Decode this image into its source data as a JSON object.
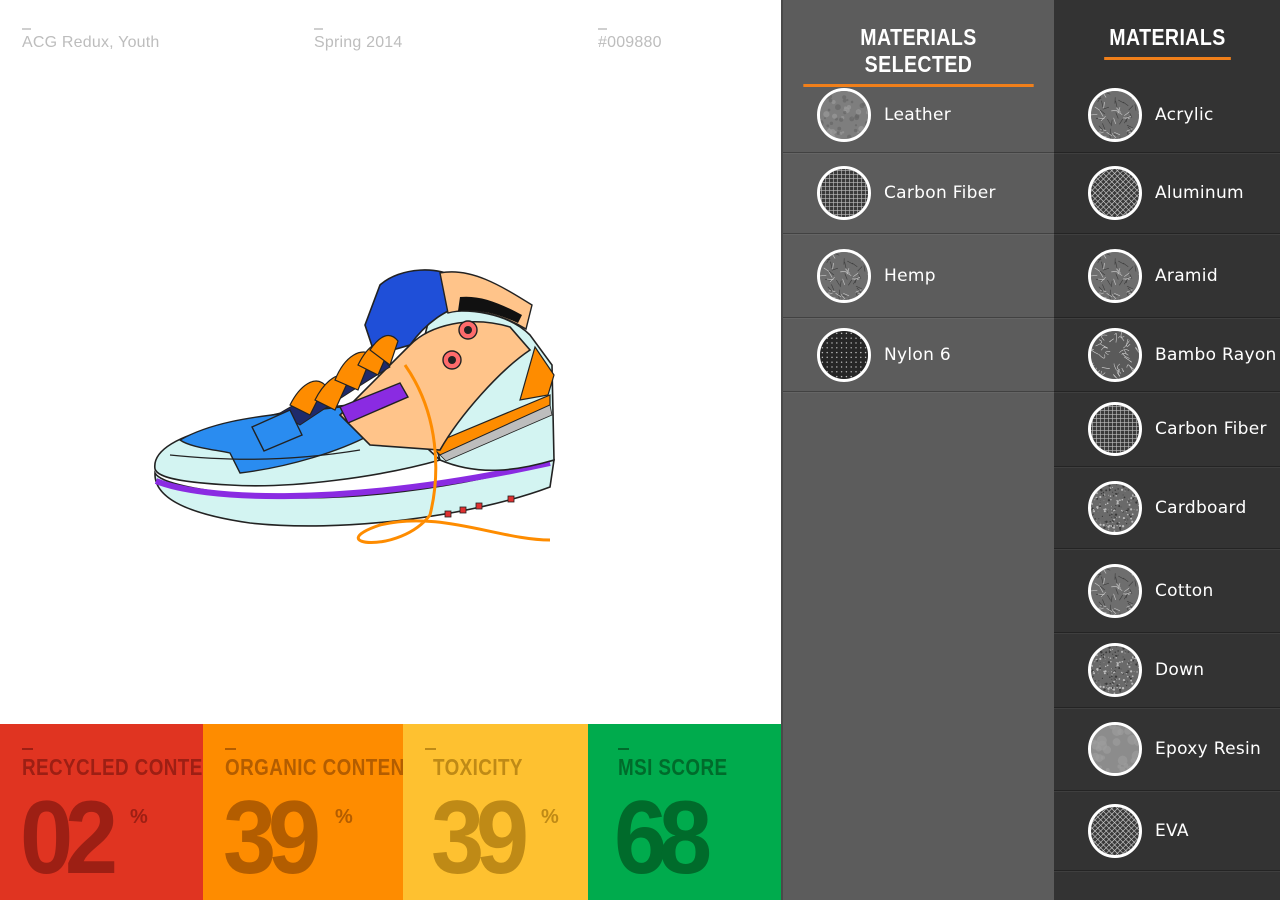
{
  "product": {
    "name": "ACG Redux, Youth",
    "season": "Spring 2014",
    "code": "#009880"
  },
  "scores": [
    {
      "key": "recycled",
      "label": "RECYCLED CONTENT",
      "value": "02",
      "unit": "%",
      "bg": "#e03421",
      "fg": "#9d1f14"
    },
    {
      "key": "organic",
      "label": "ORGANIC CONTENT",
      "value": "39",
      "unit": "%",
      "bg": "#fe8c00",
      "fg": "#b35d00"
    },
    {
      "key": "toxicity",
      "label": "TOXICITY",
      "value": "39",
      "unit": "%",
      "bg": "#fec130",
      "fg": "#bf8a16"
    },
    {
      "key": "msi",
      "label": "MSI SCORE",
      "value": "68",
      "unit": "",
      "bg": "#00ab4d",
      "fg": "#006b2b"
    }
  ],
  "selected": {
    "title": "MATERIALS SELECTED",
    "items": [
      {
        "label": "Leather",
        "texture": "leather-texture"
      },
      {
        "label": "Carbon Fiber",
        "texture": "grid-texture"
      },
      {
        "label": "Hemp",
        "texture": "fibrous-texture"
      },
      {
        "label": "Nylon 6",
        "texture": "dot-texture"
      }
    ]
  },
  "materials": {
    "title": "MATERIALS",
    "items": [
      {
        "label": "Acrylic",
        "texture": "fibrous-texture"
      },
      {
        "label": "Aluminum",
        "texture": "crosshatch-texture"
      },
      {
        "label": "Aramid",
        "texture": "fibrous-texture"
      },
      {
        "label": "Bambo Rayon",
        "texture": "weave-texture"
      },
      {
        "label": "Carbon Fiber",
        "texture": "grid-texture"
      },
      {
        "label": "Cardboard",
        "texture": "speckle-texture"
      },
      {
        "label": "Cotton",
        "texture": "fibrous-texture"
      },
      {
        "label": "Down",
        "texture": "speckle-texture"
      },
      {
        "label": "Epoxy Resin",
        "texture": "smooth-texture"
      },
      {
        "label": "EVA",
        "texture": "crosshatch-texture"
      }
    ]
  },
  "colors": {
    "accent": "#f07f1a",
    "selected_panel_bg": "#5c5c5c",
    "materials_panel_bg": "#333333"
  }
}
